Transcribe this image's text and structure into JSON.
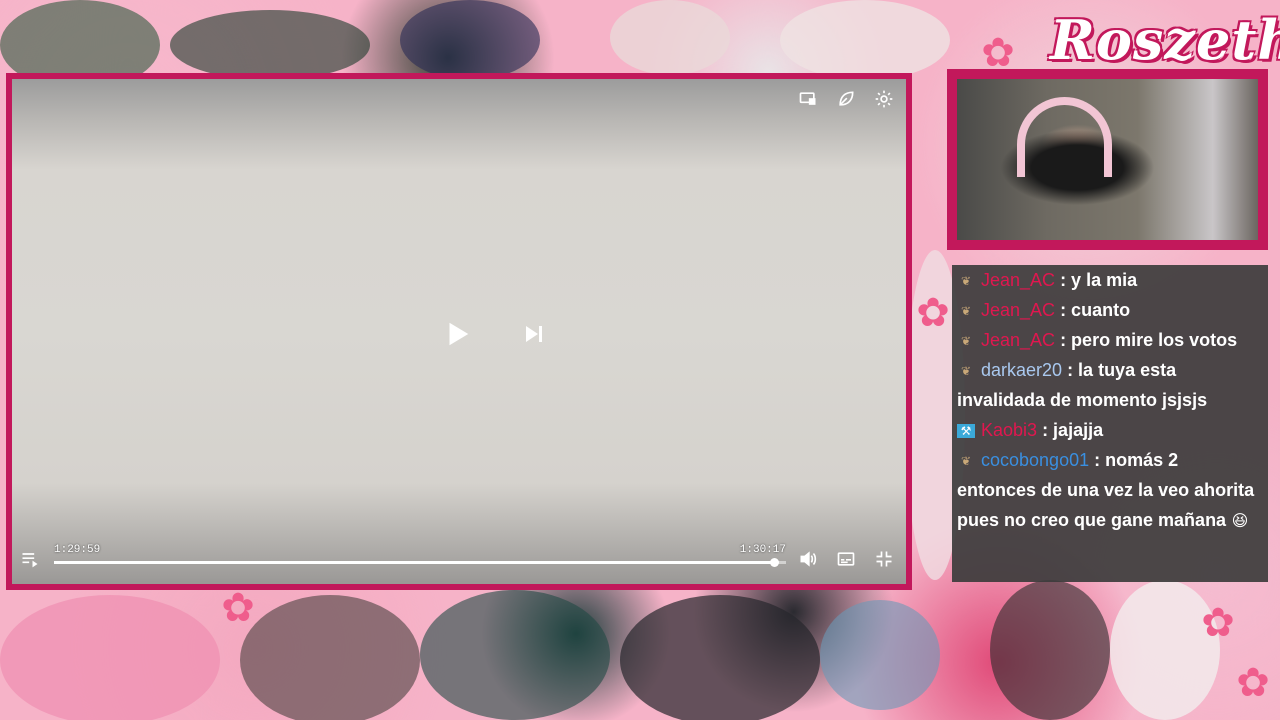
{
  "brand": {
    "name": "Roszeth"
  },
  "player": {
    "time_current": "1:29:59",
    "time_total": "1:30:17",
    "progress": 0.983,
    "icons": {
      "top": [
        "cast-icon",
        "leaf-icon",
        "gear-icon"
      ],
      "center": [
        "play-icon",
        "skip-next-icon"
      ],
      "bottom_left": "playlist-icon",
      "bottom_right": [
        "volume-icon",
        "subtitles-icon",
        "exit-fullscreen-icon"
      ]
    }
  },
  "chat": {
    "messages": [
      {
        "badge": "wings",
        "user": "Jean_AC",
        "color": "#e0174f",
        "text": ": y la mia"
      },
      {
        "badge": "wings",
        "user": "Jean_AC",
        "color": "#e0174f",
        "text": ": cuanto"
      },
      {
        "badge": "wings",
        "user": "Jean_AC",
        "color": "#e0174f",
        "text": ": pero mire los votos"
      },
      {
        "badge": "wings",
        "user": "darkaer20",
        "color": "#a9c8ef",
        "text": ": la tuya esta invalidada de momento jsjsjs"
      },
      {
        "badge": "mod",
        "user": "Kaobi3",
        "color": "#e0174f",
        "text": ": jajajja"
      },
      {
        "badge": "wings",
        "user": "cocobongo01",
        "color": "#3a8fe0",
        "text": ": nomás 2 entonces de una vez la veo ahorita pues no creo que gane mañana",
        "emoji": "😆"
      }
    ]
  },
  "colors": {
    "frame": "#c2185b",
    "background": "#f6b3c8"
  }
}
